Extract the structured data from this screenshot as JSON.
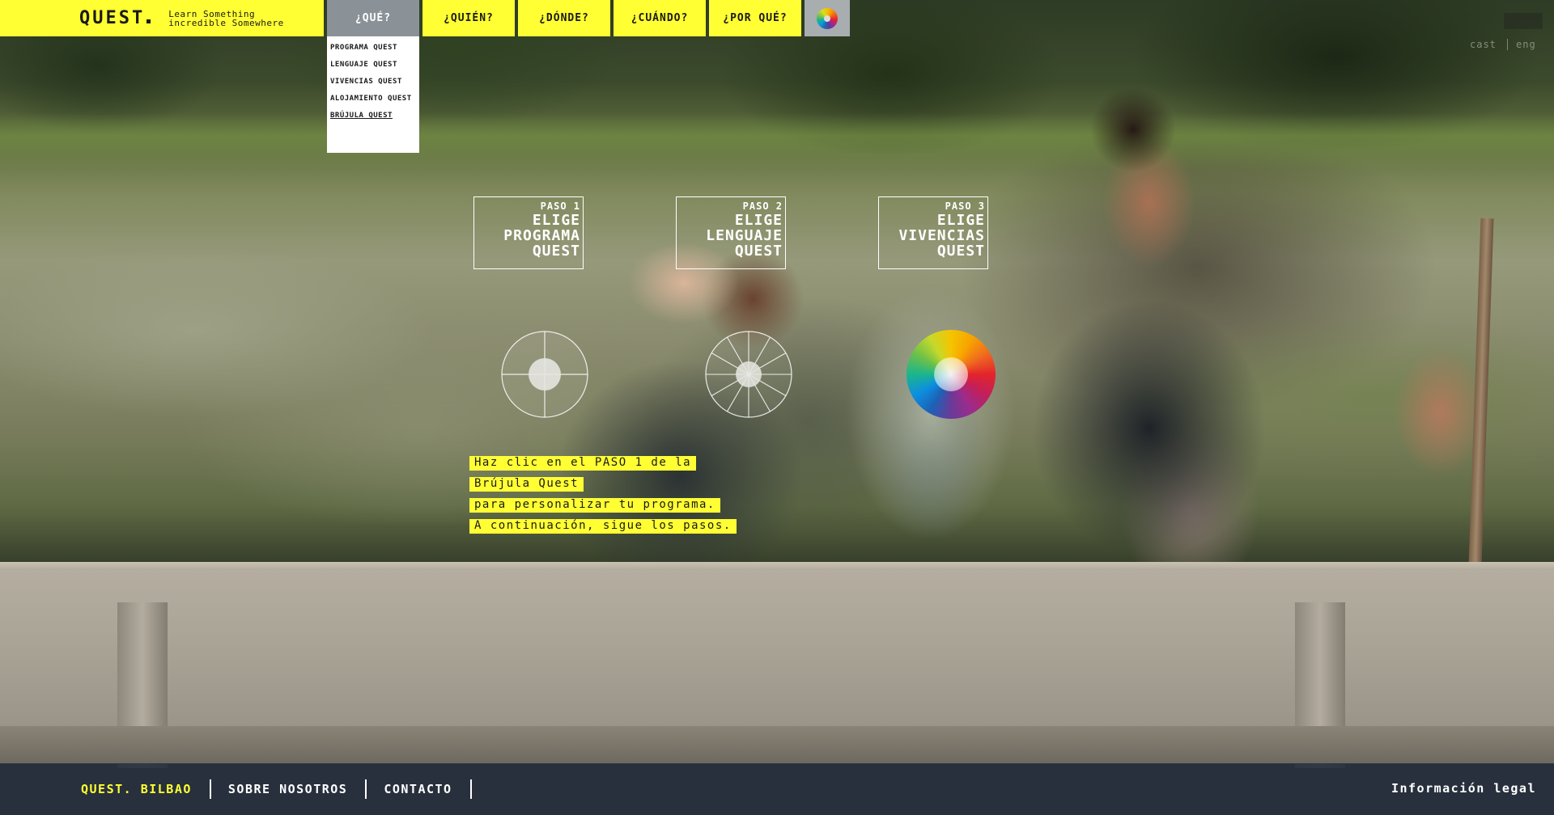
{
  "header": {
    "logo": "QUEST",
    "tagline_line1": "Learn Something",
    "tagline_line2": "incredible Somewhere"
  },
  "nav": {
    "items": [
      {
        "label": "¿QUÉ?",
        "active": true
      },
      {
        "label": "¿QUIÉN?"
      },
      {
        "label": "¿DÓNDE?"
      },
      {
        "label": "¿CUÁNDO?"
      },
      {
        "label": "¿POR QUÉ?"
      }
    ],
    "color_icon": "color-wheel-icon"
  },
  "dropdown": {
    "items": [
      "PROGRAMA QUEST",
      "LENGUAJE QUEST",
      "VIVENCIAS QUEST",
      "ALOJAMIENTO QUEST",
      "BRÚJULA QUEST"
    ],
    "current": "BRÚJULA QUEST"
  },
  "language": {
    "cast": "cast",
    "eng": "eng"
  },
  "steps": [
    {
      "kicker": "PASO 1",
      "line1": "ELIGE",
      "line2": "PROGRAMA",
      "line3": "QUEST"
    },
    {
      "kicker": "PASO 2",
      "line1": "ELIGE",
      "line2": "LENGUAJE",
      "line3": "QUEST"
    },
    {
      "kicker": "PASO 3",
      "line1": "ELIGE",
      "line2": "VIVENCIAS",
      "line3": "QUEST"
    }
  ],
  "instructions": [
    "Haz clic en el PASO 1 de la",
    "Brújula Quest",
    "para personalizar tu programa.",
    "A continuación, sigue los pasos."
  ],
  "footer": {
    "brand": "QUEST. BILBAO",
    "about": "SOBRE NOSOTROS",
    "contact": "CONTACTO",
    "legal": "Información legal"
  },
  "colors": {
    "accent": "#ffff33",
    "nav_active": "#8a9297",
    "footer_bg": "#283040"
  }
}
